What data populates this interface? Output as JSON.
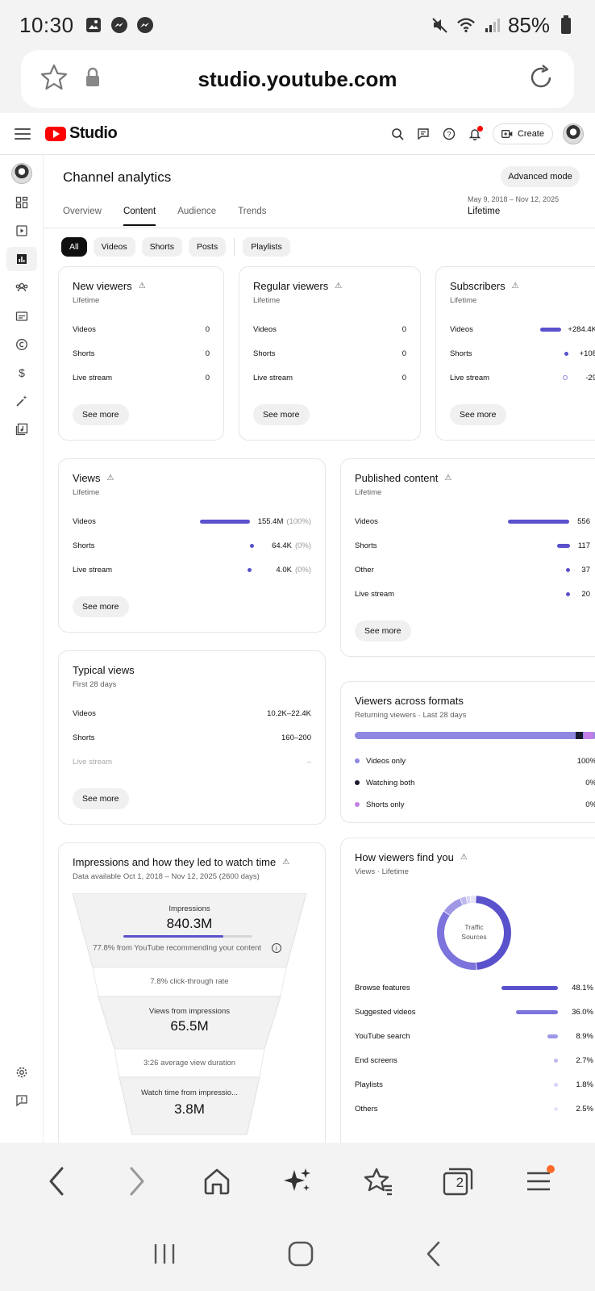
{
  "status_bar": {
    "time": "10:30",
    "battery": "85%"
  },
  "browser": {
    "url": "studio.youtube.com",
    "tab_count": "2"
  },
  "header": {
    "logo_text": "Studio",
    "create_label": "Create"
  },
  "page": {
    "title": "Channel analytics",
    "advanced_mode": "Advanced mode",
    "tabs": [
      "Overview",
      "Content",
      "Audience",
      "Trends"
    ],
    "date_range": "May 9, 2018 – Nov 12, 2025",
    "date_period": "Lifetime",
    "chips": [
      "All",
      "Videos",
      "Shorts",
      "Posts",
      "Playlists"
    ]
  },
  "see_more": "See more",
  "cards": {
    "new_viewers": {
      "title": "New viewers",
      "subtitle": "Lifetime",
      "rows": [
        {
          "label": "Videos",
          "value": "0"
        },
        {
          "label": "Shorts",
          "value": "0"
        },
        {
          "label": "Live stream",
          "value": "0"
        }
      ]
    },
    "regular_viewers": {
      "title": "Regular viewers",
      "subtitle": "Lifetime",
      "rows": [
        {
          "label": "Videos",
          "value": "0"
        },
        {
          "label": "Shorts",
          "value": "0"
        },
        {
          "label": "Live stream",
          "value": "0"
        }
      ]
    },
    "subscribers": {
      "title": "Subscribers",
      "subtitle": "Lifetime",
      "rows": [
        {
          "label": "Videos",
          "value": "+284.4K"
        },
        {
          "label": "Shorts",
          "value": "+108"
        },
        {
          "label": "Live stream",
          "value": "-29"
        }
      ]
    },
    "views": {
      "title": "Views",
      "subtitle": "Lifetime",
      "rows": [
        {
          "label": "Videos",
          "value": "155.4M",
          "pct": "(100%)",
          "fill": 1.0
        },
        {
          "label": "Shorts",
          "value": "64.4K",
          "pct": "(0%)",
          "fill": 0.0
        },
        {
          "label": "Live stream",
          "value": "4.0K",
          "pct": "(0%)",
          "fill": 0.0
        }
      ]
    },
    "published": {
      "title": "Published content",
      "subtitle": "Lifetime",
      "rows": [
        {
          "label": "Videos",
          "value": "556"
        },
        {
          "label": "Shorts",
          "value": "117"
        },
        {
          "label": "Other",
          "value": "37"
        },
        {
          "label": "Live stream",
          "value": "20"
        }
      ]
    },
    "typical_views": {
      "title": "Typical views",
      "subtitle": "First 28 days",
      "rows": [
        {
          "label": "Videos",
          "value": "10.2K–22.4K"
        },
        {
          "label": "Shorts",
          "value": "160–200"
        },
        {
          "label": "Live stream",
          "value": "–"
        }
      ]
    },
    "viewers_formats": {
      "title": "Viewers across formats",
      "subtitle": "Returning viewers · Last 28 days",
      "rows": [
        {
          "label": "Videos only",
          "value": "100%",
          "color": "#8e88e0"
        },
        {
          "label": "Watching both",
          "value": "0%",
          "color": "#1a1a2e"
        },
        {
          "label": "Shorts only",
          "value": "0%",
          "color": "#c47fe6"
        }
      ]
    },
    "impressions": {
      "title": "Impressions and how they led to watch time",
      "subtitle": "Data available Oct 1, 2018 – Nov 12, 2025 (2600 days)",
      "impressions_label": "Impressions",
      "impressions_value": "840.3M",
      "impressions_note": "77.8% from YouTube recommending your content",
      "impressions_fill": 0.778,
      "ctr": "7.8% click-through rate",
      "views_label": "Views from impressions",
      "views_value": "65.5M",
      "avg_duration": "3:26 average view duration",
      "watch_label": "Watch time from impressio...",
      "watch_value": "3.8M"
    },
    "traffic": {
      "title": "How viewers find you",
      "subtitle": "Views · Lifetime",
      "donut_label_1": "Traffic",
      "donut_label_2": "Sources",
      "rows": [
        {
          "label": "Browse features",
          "value": "48.1%",
          "pct": 48.1,
          "color": "#5a51cc"
        },
        {
          "label": "Suggested videos",
          "value": "36.0%",
          "pct": 36.0,
          "color": "#7c73dc"
        },
        {
          "label": "YouTube search",
          "value": "8.9%",
          "pct": 8.9,
          "color": "#9f98e6"
        },
        {
          "label": "End screens",
          "value": "2.7%",
          "pct": 2.7,
          "color": "#bdb8ee"
        },
        {
          "label": "Playlists",
          "value": "1.8%",
          "pct": 1.8,
          "color": "#d6d3f5"
        },
        {
          "label": "Others",
          "value": "2.5%",
          "pct": 2.5,
          "color": "#e6e4f8"
        }
      ]
    }
  },
  "colors": {
    "accent": "#5a51cc",
    "brand_red": "#ff0000"
  }
}
